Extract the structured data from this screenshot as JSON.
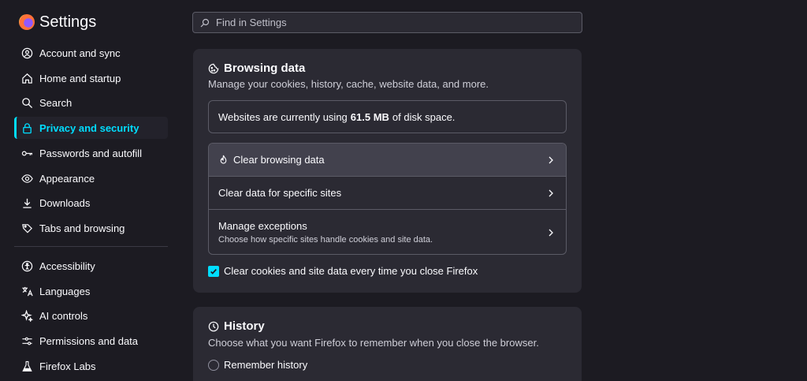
{
  "app": {
    "title": "Settings",
    "logo": "firefox-logo"
  },
  "search": {
    "placeholder": "Find in Settings",
    "icon": "search-icon"
  },
  "sidebar": {
    "items": [
      {
        "label": "Account and sync",
        "icon": "account-icon"
      },
      {
        "label": "Home and startup",
        "icon": "home-icon"
      },
      {
        "label": "Search",
        "icon": "search-icon"
      },
      {
        "label": "Privacy and security",
        "icon": "lock-icon",
        "active": true
      },
      {
        "label": "Passwords and autofill",
        "icon": "key-icon"
      },
      {
        "label": "Appearance",
        "icon": "eye-icon"
      },
      {
        "label": "Downloads",
        "icon": "download-icon"
      },
      {
        "label": "Tabs and browsing",
        "icon": "tab-icon"
      },
      {
        "label": "Accessibility",
        "icon": "accessibility-icon"
      },
      {
        "label": "Languages",
        "icon": "translate-icon"
      },
      {
        "label": "AI controls",
        "icon": "sparkle-icon"
      },
      {
        "label": "Permissions and data",
        "icon": "sliders-icon"
      },
      {
        "label": "Firefox Labs",
        "icon": "flask-icon"
      }
    ]
  },
  "browsing_data": {
    "title": "Browsing data",
    "description": "Manage your cookies, history, cache, website data, and more.",
    "usage_prefix": "Websites are currently using",
    "usage_value": "61.5 MB",
    "usage_suffix": "of disk space.",
    "rows": [
      {
        "label": "Clear browsing data",
        "icon": "fire-icon"
      },
      {
        "label": "Clear data for specific sites"
      },
      {
        "label": "Manage exceptions",
        "sublabel": "Choose how specific sites handle cookies and site data."
      }
    ],
    "checkbox": {
      "label": "Clear cookies and site data every time you close Firefox",
      "checked": true
    }
  },
  "history": {
    "title": "History",
    "description": "Choose what you want Firefox to remember when you close the browser.",
    "radio_label": "Remember history"
  },
  "colors": {
    "accent": "#00ddff",
    "background": "#1c1b22",
    "card": "#2b2a33"
  }
}
